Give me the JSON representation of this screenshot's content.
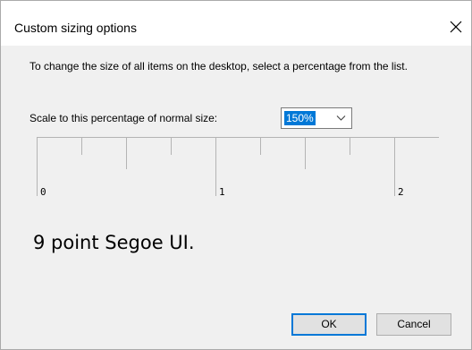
{
  "window": {
    "title": "Custom sizing options",
    "close_icon": "close-icon"
  },
  "content": {
    "description": "To change the size of all items on the desktop, select a percentage from the list.",
    "scale_label": "Scale to this percentage of normal size:",
    "scale_select": {
      "value": "150%",
      "chevron_icon": "chevron-down-icon"
    },
    "ruler": {
      "labels": [
        "0",
        "1",
        "2"
      ]
    },
    "sample_text": "9 point Segoe UI."
  },
  "buttons": {
    "ok_label": "OK",
    "cancel_label": "Cancel"
  },
  "colors": {
    "dialog_background": "#f0f0f0",
    "titlebar_background": "#ffffff",
    "selection": "#0078d7",
    "button_face": "#e1e1e1",
    "default_button_border": "#0078d7"
  }
}
